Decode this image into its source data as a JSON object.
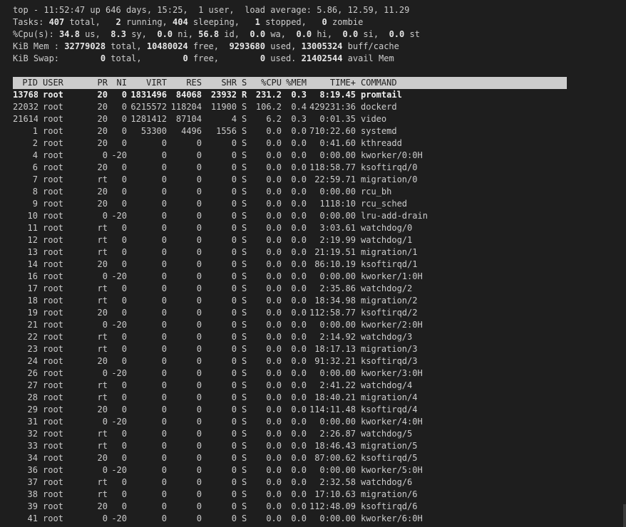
{
  "summary": {
    "top": {
      "prefix": "top - 11:52:47 up 646 days, 15:25,  1 user,  load average: 5.86, 12.59, 11.29"
    },
    "tasks": {
      "label": "Tasks: ",
      "total": "407",
      "total_lbl": " total,   ",
      "running": "2",
      "running_lbl": " running, ",
      "sleeping": "404",
      "sleeping_lbl": " sleeping,   ",
      "stopped": "1",
      "stopped_lbl": " stopped,   ",
      "zombie": "0",
      "zombie_lbl": " zombie"
    },
    "cpu": {
      "label": "%Cpu(s): ",
      "us": "34.8",
      "us_lbl": " us,  ",
      "sy": "8.3",
      "sy_lbl": " sy,  ",
      "ni": "0.0",
      "ni_lbl": " ni, ",
      "id": "56.8",
      "id_lbl": " id,  ",
      "wa": "0.0",
      "wa_lbl": " wa,  ",
      "hi": "0.0",
      "hi_lbl": " hi,  ",
      "si": "0.0",
      "si_lbl": " si,  ",
      "st": "0.0",
      "st_lbl": " st"
    },
    "mem": {
      "label": "KiB Mem : ",
      "total": "32779028",
      "total_lbl": " total, ",
      "free": "10480024",
      "free_lbl": " free,  ",
      "used": "9293680",
      "used_lbl": " used, ",
      "cache": "13005324",
      "cache_lbl": " buff/cache"
    },
    "swap": {
      "label": "KiB Swap:        ",
      "total": "0",
      "total_lbl": " total,        ",
      "free": "0",
      "free_lbl": " free,        ",
      "used": "0",
      "used_lbl": " used. ",
      "avail": "21402544",
      "avail_lbl": " avail Mem"
    }
  },
  "columns": [
    "PID",
    "USER",
    "PR",
    "NI",
    "VIRT",
    "RES",
    "SHR",
    "S",
    "%CPU",
    "%MEM",
    "TIME+",
    "COMMAND"
  ],
  "processes": [
    [
      "13768",
      "root",
      "20",
      "0",
      "1831496",
      "84068",
      "23932",
      "R",
      "231.2",
      "0.3",
      "8:19.45",
      "promtail"
    ],
    [
      "22032",
      "root",
      "20",
      "0",
      "6215572",
      "118204",
      "11900",
      "S",
      "106.2",
      "0.4",
      "429231:36",
      "dockerd"
    ],
    [
      "21614",
      "root",
      "20",
      "0",
      "1281412",
      "87104",
      "4",
      "S",
      "6.2",
      "0.3",
      "0:01.35",
      "video"
    ],
    [
      "1",
      "root",
      "20",
      "0",
      "53300",
      "4496",
      "1556",
      "S",
      "0.0",
      "0.0",
      "710:22.60",
      "systemd"
    ],
    [
      "2",
      "root",
      "20",
      "0",
      "0",
      "0",
      "0",
      "S",
      "0.0",
      "0.0",
      "0:41.60",
      "kthreadd"
    ],
    [
      "4",
      "root",
      "0",
      "-20",
      "0",
      "0",
      "0",
      "S",
      "0.0",
      "0.0",
      "0:00.00",
      "kworker/0:0H"
    ],
    [
      "6",
      "root",
      "20",
      "0",
      "0",
      "0",
      "0",
      "S",
      "0.0",
      "0.0",
      "118:58.77",
      "ksoftirqd/0"
    ],
    [
      "7",
      "root",
      "rt",
      "0",
      "0",
      "0",
      "0",
      "S",
      "0.0",
      "0.0",
      "22:59.71",
      "migration/0"
    ],
    [
      "8",
      "root",
      "20",
      "0",
      "0",
      "0",
      "0",
      "S",
      "0.0",
      "0.0",
      "0:00.00",
      "rcu_bh"
    ],
    [
      "9",
      "root",
      "20",
      "0",
      "0",
      "0",
      "0",
      "S",
      "0.0",
      "0.0",
      "1118:10",
      "rcu_sched"
    ],
    [
      "10",
      "root",
      "0",
      "-20",
      "0",
      "0",
      "0",
      "S",
      "0.0",
      "0.0",
      "0:00.00",
      "lru-add-drain"
    ],
    [
      "11",
      "root",
      "rt",
      "0",
      "0",
      "0",
      "0",
      "S",
      "0.0",
      "0.0",
      "3:03.61",
      "watchdog/0"
    ],
    [
      "12",
      "root",
      "rt",
      "0",
      "0",
      "0",
      "0",
      "S",
      "0.0",
      "0.0",
      "2:19.99",
      "watchdog/1"
    ],
    [
      "13",
      "root",
      "rt",
      "0",
      "0",
      "0",
      "0",
      "S",
      "0.0",
      "0.0",
      "21:19.51",
      "migration/1"
    ],
    [
      "14",
      "root",
      "20",
      "0",
      "0",
      "0",
      "0",
      "S",
      "0.0",
      "0.0",
      "86:10.19",
      "ksoftirqd/1"
    ],
    [
      "16",
      "root",
      "0",
      "-20",
      "0",
      "0",
      "0",
      "S",
      "0.0",
      "0.0",
      "0:00.00",
      "kworker/1:0H"
    ],
    [
      "17",
      "root",
      "rt",
      "0",
      "0",
      "0",
      "0",
      "S",
      "0.0",
      "0.0",
      "2:35.86",
      "watchdog/2"
    ],
    [
      "18",
      "root",
      "rt",
      "0",
      "0",
      "0",
      "0",
      "S",
      "0.0",
      "0.0",
      "18:34.98",
      "migration/2"
    ],
    [
      "19",
      "root",
      "20",
      "0",
      "0",
      "0",
      "0",
      "S",
      "0.0",
      "0.0",
      "112:58.77",
      "ksoftirqd/2"
    ],
    [
      "21",
      "root",
      "0",
      "-20",
      "0",
      "0",
      "0",
      "S",
      "0.0",
      "0.0",
      "0:00.00",
      "kworker/2:0H"
    ],
    [
      "22",
      "root",
      "rt",
      "0",
      "0",
      "0",
      "0",
      "S",
      "0.0",
      "0.0",
      "2:14.92",
      "watchdog/3"
    ],
    [
      "23",
      "root",
      "rt",
      "0",
      "0",
      "0",
      "0",
      "S",
      "0.0",
      "0.0",
      "18:17.13",
      "migration/3"
    ],
    [
      "24",
      "root",
      "20",
      "0",
      "0",
      "0",
      "0",
      "S",
      "0.0",
      "0.0",
      "91:32.21",
      "ksoftirqd/3"
    ],
    [
      "26",
      "root",
      "0",
      "-20",
      "0",
      "0",
      "0",
      "S",
      "0.0",
      "0.0",
      "0:00.00",
      "kworker/3:0H"
    ],
    [
      "27",
      "root",
      "rt",
      "0",
      "0",
      "0",
      "0",
      "S",
      "0.0",
      "0.0",
      "2:41.22",
      "watchdog/4"
    ],
    [
      "28",
      "root",
      "rt",
      "0",
      "0",
      "0",
      "0",
      "S",
      "0.0",
      "0.0",
      "18:40.21",
      "migration/4"
    ],
    [
      "29",
      "root",
      "20",
      "0",
      "0",
      "0",
      "0",
      "S",
      "0.0",
      "0.0",
      "114:11.48",
      "ksoftirqd/4"
    ],
    [
      "31",
      "root",
      "0",
      "-20",
      "0",
      "0",
      "0",
      "S",
      "0.0",
      "0.0",
      "0:00.00",
      "kworker/4:0H"
    ],
    [
      "32",
      "root",
      "rt",
      "0",
      "0",
      "0",
      "0",
      "S",
      "0.0",
      "0.0",
      "2:26.87",
      "watchdog/5"
    ],
    [
      "33",
      "root",
      "rt",
      "0",
      "0",
      "0",
      "0",
      "S",
      "0.0",
      "0.0",
      "18:46.43",
      "migration/5"
    ],
    [
      "34",
      "root",
      "20",
      "0",
      "0",
      "0",
      "0",
      "S",
      "0.0",
      "0.0",
      "87:00.62",
      "ksoftirqd/5"
    ],
    [
      "36",
      "root",
      "0",
      "-20",
      "0",
      "0",
      "0",
      "S",
      "0.0",
      "0.0",
      "0:00.00",
      "kworker/5:0H"
    ],
    [
      "37",
      "root",
      "rt",
      "0",
      "0",
      "0",
      "0",
      "S",
      "0.0",
      "0.0",
      "2:32.58",
      "watchdog/6"
    ],
    [
      "38",
      "root",
      "rt",
      "0",
      "0",
      "0",
      "0",
      "S",
      "0.0",
      "0.0",
      "17:10.63",
      "migration/6"
    ],
    [
      "39",
      "root",
      "20",
      "0",
      "0",
      "0",
      "0",
      "S",
      "0.0",
      "0.0",
      "112:48.09",
      "ksoftirqd/6"
    ],
    [
      "41",
      "root",
      "0",
      "-20",
      "0",
      "0",
      "0",
      "S",
      "0.0",
      "0.0",
      "0:00.00",
      "kworker/6:0H"
    ]
  ]
}
